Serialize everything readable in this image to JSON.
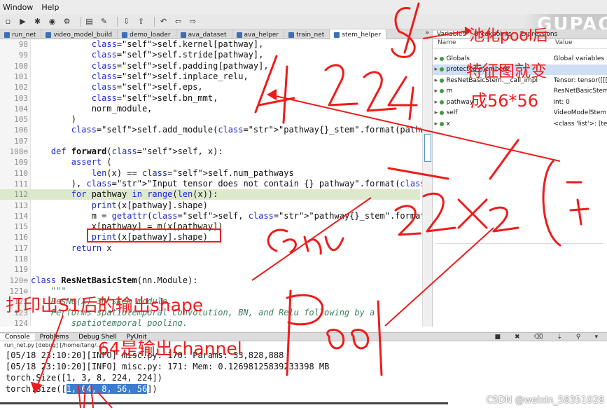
{
  "menubar": [
    "Window",
    "Help"
  ],
  "editor_tabs": [
    {
      "label": "run_net",
      "active": false
    },
    {
      "label": "video_model_build",
      "active": false
    },
    {
      "label": "demo_loader",
      "active": false
    },
    {
      "label": "ava_dataset",
      "active": false
    },
    {
      "label": "ava_helper",
      "active": false
    },
    {
      "label": "train_net",
      "active": false
    },
    {
      "label": "stem_helper",
      "active": true
    }
  ],
  "editor_tabs_overflow": "»",
  "code": [
    {
      "n": "98",
      "t": "            self.kernel[pathway],"
    },
    {
      "n": "99",
      "t": "            self.stride[pathway],"
    },
    {
      "n": "100",
      "t": "            self.padding[pathway],"
    },
    {
      "n": "101",
      "t": "            self.inplace_relu,"
    },
    {
      "n": "102",
      "t": "            self.eps,"
    },
    {
      "n": "103",
      "t": "            self.bn_mmt,"
    },
    {
      "n": "104",
      "t": "            norm_module,"
    },
    {
      "n": "105",
      "t": "        )"
    },
    {
      "n": "106",
      "t": "        self.add_module(\"pathway{}_stem\".format(pathway), stem)"
    },
    {
      "n": "107",
      "t": ""
    },
    {
      "n": "108⊖",
      "t": "    def forward(self, x):"
    },
    {
      "n": "109",
      "t": "        assert ("
    },
    {
      "n": "110",
      "t": "            len(x) == self.num_pathways"
    },
    {
      "n": "111",
      "t": "        ), \"Input tensor does not contain {} pathway\".format(self.num_pathway"
    },
    {
      "n": "112",
      "t": "        for pathway in range(len(x)):"
    },
    {
      "n": "113",
      "t": "            print(x[pathway].shape)"
    },
    {
      "n": "114",
      "t": "            m = getattr(self, \"pathway{}_stem\".format(pathway))"
    },
    {
      "n": "115",
      "t": "            x[pathway] = m(x[pathway])"
    },
    {
      "n": "116",
      "t": "            print(x[pathway].shape)"
    },
    {
      "n": "117",
      "t": "        return x"
    },
    {
      "n": "118",
      "t": ""
    },
    {
      "n": "119",
      "t": ""
    },
    {
      "n": "120⊖",
      "t": "class ResNetBasicStem(nn.Module):"
    },
    {
      "n": "121⊖",
      "t": "    \"\"\""
    },
    {
      "n": "122",
      "t": "    ResNe(X) 3D stem module."
    },
    {
      "n": "123",
      "t": "    Performs spatiotemporal Convolution, BN, and Relu following by a"
    },
    {
      "n": "124",
      "t": "        spatiotemporal pooling."
    }
  ],
  "variables": {
    "tabs": [
      "Variables",
      "Breakpoints",
      "Expressions"
    ],
    "columns": [
      "Name",
      "Value"
    ],
    "rows": [
      {
        "name": "Globals",
        "value": "Global variables",
        "selected": false
      },
      {
        "name": "protected members",
        "value": "",
        "selected": true
      },
      {
        "name": "ResNetBasicStem.__call_impl",
        "value": "Tensor: tensor([[[",
        "selected": false
      },
      {
        "name": "m",
        "value": "ResNetBasicStem",
        "selected": false
      },
      {
        "name": "pathway",
        "value": "int: 0",
        "selected": false
      },
      {
        "name": "self",
        "value": "VideoModelStem",
        "selected": false
      },
      {
        "name": "x",
        "value": "<class 'list'>: [tens",
        "selected": false
      }
    ]
  },
  "console": {
    "tabs": [
      "Console",
      "Problems",
      "Debug Shell",
      "PyUnit"
    ],
    "process": "run_net.py [debug] [/home/tang/...]",
    "lines": [
      "[05/18 23:10:20][INFO] misc.py: 170: Params: 33,828,888",
      "[05/18 23:10:20][INFO] misc.py: 171: Mem: 0.12698125839233398 MB",
      "torch.Size([1, 3, 8, 224, 224])"
    ],
    "last_prefix": "torch.Size([",
    "last_selected": "1, 64, 8, 56, 56",
    "last_suffix": "])"
  },
  "annotations": {
    "pool_title": "池化pool后",
    "pool_line2": "特征图就变",
    "pool_line3": "成56*56",
    "print_note": "打印出S1后的输出shape",
    "channel_note": "64是输出channel",
    "color": "#ee1b1b"
  },
  "watermark": "CSDN @weixin_58351028",
  "corner_logo": "GUPAO"
}
